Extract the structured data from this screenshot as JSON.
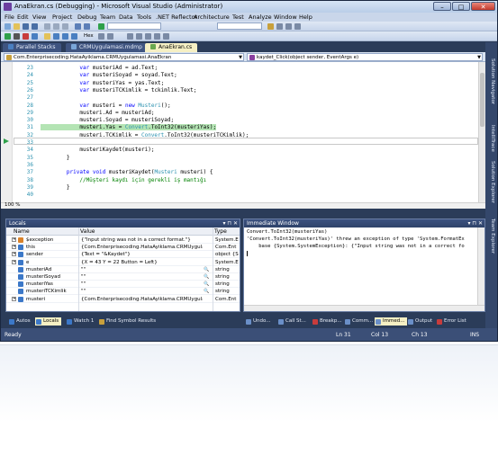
{
  "window": {
    "title": "AnaEkran.cs (Debugging) - Microsoft Visual Studio (Administrator)",
    "min_glyph": "–",
    "max_glyph": "□",
    "close_glyph": "✕"
  },
  "menu": [
    "File",
    "Edit",
    "View",
    "Project",
    "Debug",
    "Team",
    "Data",
    "Tools",
    ".NET Reflector",
    "Architecture",
    "Test",
    "Analyze",
    "Window",
    "Help"
  ],
  "toolbar": {
    "hex_label": "Hex"
  },
  "doc_tabs": [
    {
      "label": "Parallel Stacks",
      "color": "#4a7fc1"
    },
    {
      "label": "CRMUygulamasi.mdmp",
      "color": "#7aa6d8"
    },
    {
      "label": "AnaEkran.cs",
      "color": "#6aa84f"
    }
  ],
  "nav": {
    "class_combo": "Com.Enterprisecoding.HataAyiklama.CRMUygulamasi.AnaEkran",
    "method_combo": "kaydet_Click(object sender, EventArgs e)"
  },
  "side_tabs": [
    "Solution Navigator",
    "IntelliTrace",
    "Solution Explorer",
    "Team Explorer"
  ],
  "editor": {
    "zoom": "100 %",
    "current_line": "31",
    "lines": [
      {
        "num": "23",
        "code": "            var musteriAd = ad.Text;"
      },
      {
        "num": "24",
        "code": "            var musteriSoyad = soyad.Text;"
      },
      {
        "num": "25",
        "code": "            var musteriYas = yas.Text;"
      },
      {
        "num": "26",
        "code": "            var musteriTCKimlik = tckimlik.Text;"
      },
      {
        "num": "27",
        "code": ""
      },
      {
        "num": "28",
        "code": "            var musteri = new Musteri();"
      },
      {
        "num": "29",
        "code": "            musteri.Ad = musteriAd;"
      },
      {
        "num": "30",
        "code": "            musteri.Soyad = musteriSoyad;"
      },
      {
        "num": "31",
        "code": "            musteri.Yas = Convert.ToInt32(musteriYas);"
      },
      {
        "num": "32",
        "code": "            musteri.TCKimlik = Convert.ToInt32(musteriTCKimlik);"
      },
      {
        "num": "33",
        "code": ""
      },
      {
        "num": "34",
        "code": "            musteriKaydet(musteri);"
      },
      {
        "num": "35",
        "code": "        }"
      },
      {
        "num": "36",
        "code": ""
      },
      {
        "num": "37",
        "code": "        private void musteriKaydet(Musteri musteri) {"
      },
      {
        "num": "38",
        "code": "            //Müşteri kaydı için gerekli iş mantığı"
      },
      {
        "num": "39",
        "code": "        }"
      },
      {
        "num": "40",
        "code": ""
      }
    ]
  },
  "locals": {
    "title": "Locals",
    "columns": [
      "Name",
      "Value",
      "Type"
    ],
    "rows": [
      {
        "name": "$exception",
        "value": "{\"Input string was not in a correct format.\"}",
        "type": "System.E",
        "icon": "#d9822b",
        "expand": "+"
      },
      {
        "name": "this",
        "value": "{Com.Enterprisecoding.HataAyiklama.CRMUygulam",
        "type": "Com.Ent",
        "icon": "#3c78c8",
        "expand": "+"
      },
      {
        "name": "sender",
        "value": "{Text = \"&Kaydet\"}",
        "type": "object {S",
        "icon": "#3c78c8",
        "expand": "+"
      },
      {
        "name": "e",
        "value": "{X = 43 Y = 22 Button = Left}",
        "type": "System.E",
        "icon": "#3c78c8",
        "expand": "+"
      },
      {
        "name": "musteriAd",
        "value": "\"\"",
        "type": "string",
        "icon": "#3c78c8",
        "expand": ""
      },
      {
        "name": "musteriSoyad",
        "value": "\"\"",
        "type": "string",
        "icon": "#3c78c8",
        "expand": ""
      },
      {
        "name": "musteriYas",
        "value": "\"\"",
        "type": "string",
        "icon": "#3c78c8",
        "expand": ""
      },
      {
        "name": "musteriTCKimlik",
        "value": "\"\"",
        "type": "string",
        "icon": "#3c78c8",
        "expand": ""
      },
      {
        "name": "musteri",
        "value": "{Com.Enterprisecoding.HataAyiklama.CRMUygulam",
        "type": "Com.Ent",
        "icon": "#3c78c8",
        "expand": "+"
      }
    ]
  },
  "immediate": {
    "title": "Immediate Window",
    "lines": [
      "Convert.ToInt32(musteriYas)",
      "'Convert.ToInt32(musteriYas)' threw an exception of type 'System.FormatEx",
      "    base {System.SystemException}: {\"Input string was not in a correct fo"
    ]
  },
  "bottom_tabs_left": [
    {
      "label": "Autos",
      "color": "#3c78c8"
    },
    {
      "label": "Locals",
      "color": "#3c78c8",
      "active": true
    },
    {
      "label": "Watch 1",
      "color": "#3c78c8"
    },
    {
      "label": "Find Symbol Results",
      "color": "#c8a03c"
    }
  ],
  "bottom_tabs_right": [
    {
      "label": "Undo...",
      "color": "#6a8fc8"
    },
    {
      "label": "Call St...",
      "color": "#6a8fc8"
    },
    {
      "label": "Breakp...",
      "color": "#c83c3c"
    },
    {
      "label": "Comm...",
      "color": "#6a8fc8"
    },
    {
      "label": "Immed...",
      "color": "#6a8fc8",
      "active": true
    },
    {
      "label": "Output",
      "color": "#6a8fc8"
    },
    {
      "label": "Error List",
      "color": "#c83c3c"
    }
  ],
  "status": {
    "ready": "Ready",
    "ln": "Ln 31",
    "col": "Col 13",
    "ch": "Ch 13",
    "ins": "INS"
  },
  "colors": {
    "accent": "#2b3c59",
    "active_tab": "#f6f0c4",
    "highlight_line": "#b4e4b4"
  }
}
